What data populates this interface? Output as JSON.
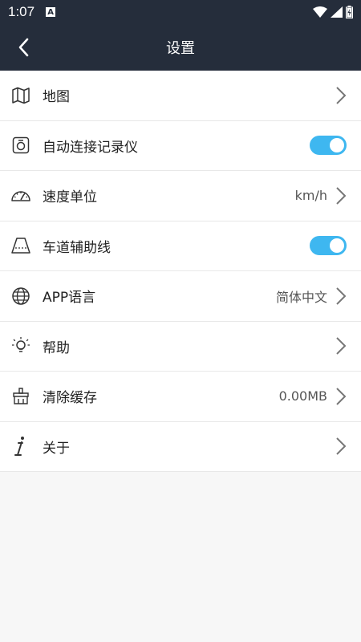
{
  "status_bar": {
    "time": "1:07",
    "notification_icon": "A"
  },
  "header": {
    "title": "设置"
  },
  "items": [
    {
      "label": "地图",
      "icon": "map-icon",
      "value": "",
      "control": "chevron"
    },
    {
      "label": "自动连接记录仪",
      "icon": "dashcam-icon",
      "value": "",
      "control": "toggle",
      "on": true
    },
    {
      "label": "速度单位",
      "icon": "speedometer-icon",
      "value": "km/h",
      "control": "chevron"
    },
    {
      "label": "车道辅助线",
      "icon": "lane-icon",
      "value": "",
      "control": "toggle",
      "on": true
    },
    {
      "label": "APP语言",
      "icon": "globe-icon",
      "value": "简体中文",
      "control": "chevron"
    },
    {
      "label": "帮助",
      "icon": "lightbulb-icon",
      "value": "",
      "control": "chevron"
    },
    {
      "label": "清除缓存",
      "icon": "broom-icon",
      "value": "0.00MB",
      "control": "chevron"
    },
    {
      "label": "关于",
      "icon": "info-icon",
      "value": "",
      "control": "chevron"
    }
  ],
  "colors": {
    "header_bg": "#252d3b",
    "toggle_on": "#3eb7f0"
  }
}
